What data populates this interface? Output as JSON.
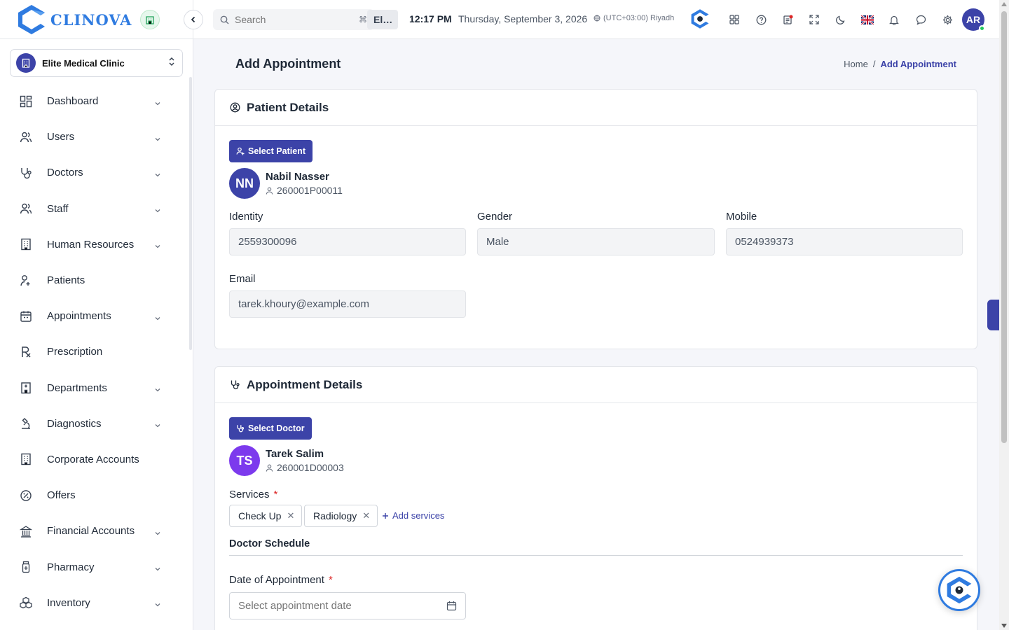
{
  "app": {
    "name": "CLINOVA"
  },
  "clinic_selector": {
    "value": "Elite Medical Clinic",
    "chip": "El…"
  },
  "sidebar": {
    "items": [
      {
        "label": "Dashboard",
        "icon": "dashboard-icon",
        "has_submenu": true
      },
      {
        "label": "Users",
        "icon": "users-icon",
        "has_submenu": true
      },
      {
        "label": "Doctors",
        "icon": "stethoscope-icon",
        "has_submenu": true
      },
      {
        "label": "Staff",
        "icon": "staff-icon",
        "has_submenu": true
      },
      {
        "label": "Human Resources",
        "icon": "building-icon",
        "has_submenu": true
      },
      {
        "label": "Patients",
        "icon": "patient-icon",
        "has_submenu": false
      },
      {
        "label": "Appointments",
        "icon": "calendar-icon",
        "has_submenu": true
      },
      {
        "label": "Prescription",
        "icon": "rx-icon",
        "has_submenu": false
      },
      {
        "label": "Departments",
        "icon": "hospital-icon",
        "has_submenu": true
      },
      {
        "label": "Diagnostics",
        "icon": "microscope-icon",
        "has_submenu": true
      },
      {
        "label": "Corporate Accounts",
        "icon": "corporate-building-icon",
        "has_submenu": false
      },
      {
        "label": "Offers",
        "icon": "discount-icon",
        "has_submenu": false
      },
      {
        "label": "Financial Accounts",
        "icon": "bank-icon",
        "has_submenu": true
      },
      {
        "label": "Pharmacy",
        "icon": "medicine-bottle-icon",
        "has_submenu": true
      },
      {
        "label": "Inventory",
        "icon": "boxes-icon",
        "has_submenu": true
      }
    ]
  },
  "topbar": {
    "search_placeholder": "Search",
    "search_shortcut": "⌘",
    "time": "12:17 PM",
    "date": "Thursday, September 3, 2026",
    "timezone": "(UTC+03:00) Riyadh",
    "user_initials": "AR"
  },
  "page": {
    "title": "Add Appointment",
    "breadcrumb": {
      "home": "Home",
      "separator": "/",
      "current": "Add Appointment"
    }
  },
  "patient_card": {
    "title": "Patient Details",
    "select_button": "Select Patient",
    "patient": {
      "initials": "NN",
      "name": "Nabil Nasser",
      "code": "260001P00011"
    },
    "fields": {
      "identity": {
        "label": "Identity",
        "value": "2559300096"
      },
      "gender": {
        "label": "Gender",
        "value": "Male"
      },
      "mobile": {
        "label": "Mobile",
        "value": "0524939373"
      },
      "email": {
        "label": "Email",
        "value": "tarek.khoury@example.com"
      }
    }
  },
  "appointment_card": {
    "title": "Appointment Details",
    "select_button": "Select Doctor",
    "doctor": {
      "initials": "TS",
      "name": "Tarek Salim",
      "code": "260001D00003"
    },
    "services_label": "Services",
    "required_mark": "*",
    "services": [
      "Check Up",
      "Radiology"
    ],
    "add_services": "Add services",
    "schedule_heading": "Doctor Schedule",
    "date_label": "Date of Appointment",
    "date_placeholder": "Select appointment date"
  },
  "colors": {
    "primary": "#3c43a8",
    "brand_blue": "#2f7be0",
    "doctor_avatar": "#7c3aed",
    "online": "#22c55e"
  }
}
